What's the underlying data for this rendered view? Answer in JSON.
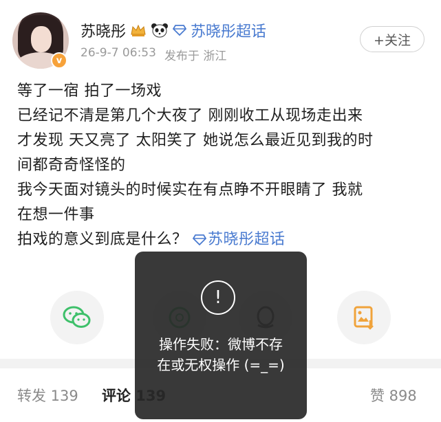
{
  "post": {
    "username": "苏晓彤",
    "supertopic_label": "苏晓彤超话",
    "timestamp": "26-9-7 06:53",
    "location": "发布于 浙江",
    "follow_label": "+关注",
    "verified_badge": "v",
    "lines": [
      "等了一宿 拍了一场戏",
      "已经记不清是第几个大夜了 刚刚收工从现场走出来",
      "才发现 天又亮了 太阳笑了 她说怎么最近见到我的时",
      "间都奇奇怪怪的",
      "我今天面对镜头的时候实在有点睁不开眼睛了 我就",
      "在想一件事",
      "拍戏的意义到底是什么？"
    ],
    "inline_tag": "苏晓彤超话"
  },
  "share": {
    "icons": [
      "wechat-icon",
      "moments-icon",
      "qq-icon",
      "save-image-icon"
    ]
  },
  "tabs": {
    "repost": "转发 139",
    "comments": "评论 139",
    "likes": "赞 898"
  },
  "toast": {
    "icon": "!",
    "message": "操作失败：微博不存\n在或无权操作 (=_=)"
  },
  "colors": {
    "link": "#4a7bd0",
    "badge": "#f7a23a",
    "toast_bg": "#282828"
  }
}
